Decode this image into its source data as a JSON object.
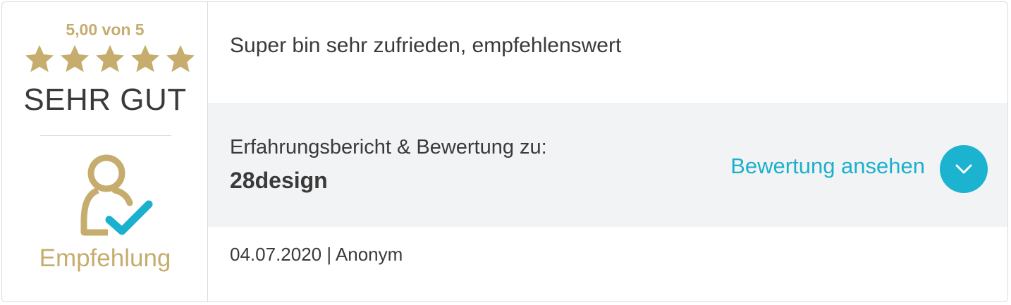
{
  "rating": {
    "score_text": "5,00 von 5",
    "stars_filled": 5,
    "stars_total": 5,
    "grade": "SEHR GUT",
    "recommendation": "Empfehlung",
    "gold_color": "#c6ad6e",
    "check_color": "#1bb0cd"
  },
  "review": {
    "comment": "Super bin sehr zufrieden, empfehlenswert",
    "reference_label": "Erfahrungsbericht & Bewertung zu:",
    "company": "28design",
    "view_link": "Bewertung ansehen",
    "meta": "04.07.2020 | Anonym",
    "accent_color": "#1cb3d1"
  },
  "icons": {
    "star": "star-icon",
    "user_check": "user-check-icon",
    "chevron": "chevron-down-icon"
  }
}
